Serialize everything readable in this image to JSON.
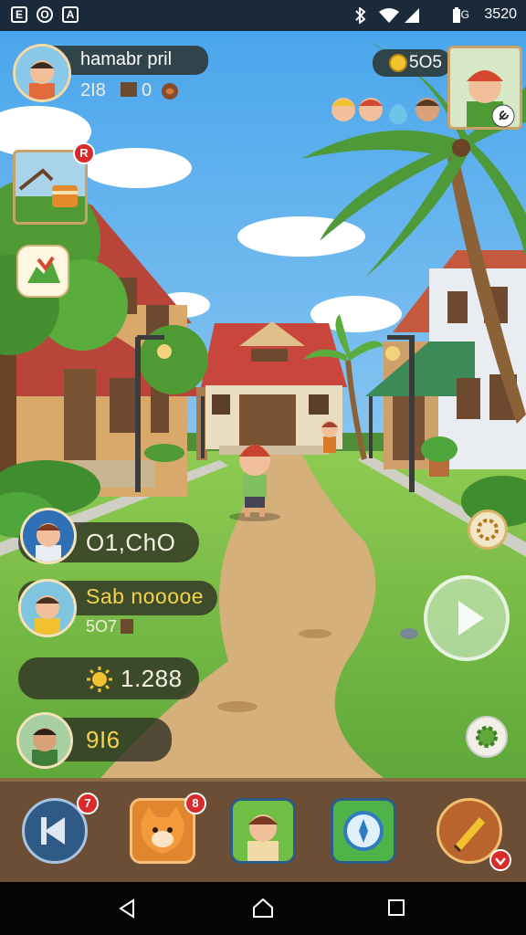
{
  "status_bar": {
    "left_icons": [
      "E",
      "O",
      "A"
    ],
    "carrier": "3G",
    "time": "3520"
  },
  "player": {
    "name": "hamabr pril",
    "stat_a": "2I8",
    "stat_b": "0"
  },
  "coins": "5O5",
  "stats": [
    {
      "text": "O1,ChO"
    },
    {
      "text": "Sab nooooe",
      "sub": "5O7"
    },
    {
      "text": "1.288"
    },
    {
      "text": "9I6"
    }
  ],
  "quest_badge": "R",
  "bottom_bar": {
    "badges": [
      "7",
      "8"
    ]
  },
  "colors": {
    "sky": "#63b6ef",
    "grass": "#7ec24a",
    "path": "#d6b07a",
    "roof": "#c9463d",
    "bar": "#6b4e35",
    "badge": "#d92b2b",
    "gold": "#f2c12e"
  }
}
